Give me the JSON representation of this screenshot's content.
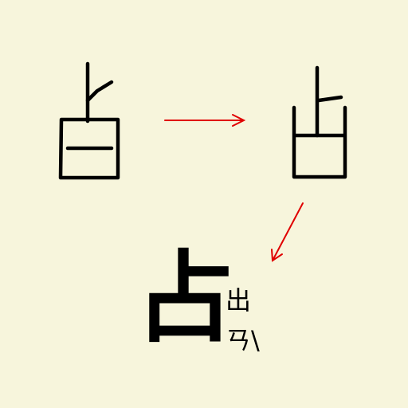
{
  "canvas": {
    "background": "#f7f5dc"
  },
  "stroke_color": "#000000",
  "arrow_color": "#e00000",
  "stages": [
    {
      "name": "oracle-bone-form"
    },
    {
      "name": "bronze-form"
    }
  ],
  "arrows": [
    {
      "from": "oracle-bone-form",
      "to": "bronze-form"
    },
    {
      "from": "bronze-form",
      "to": "modern-character"
    }
  ],
  "modern_character": {
    "glyph": "占",
    "annotation": "出ㄢ\\"
  }
}
